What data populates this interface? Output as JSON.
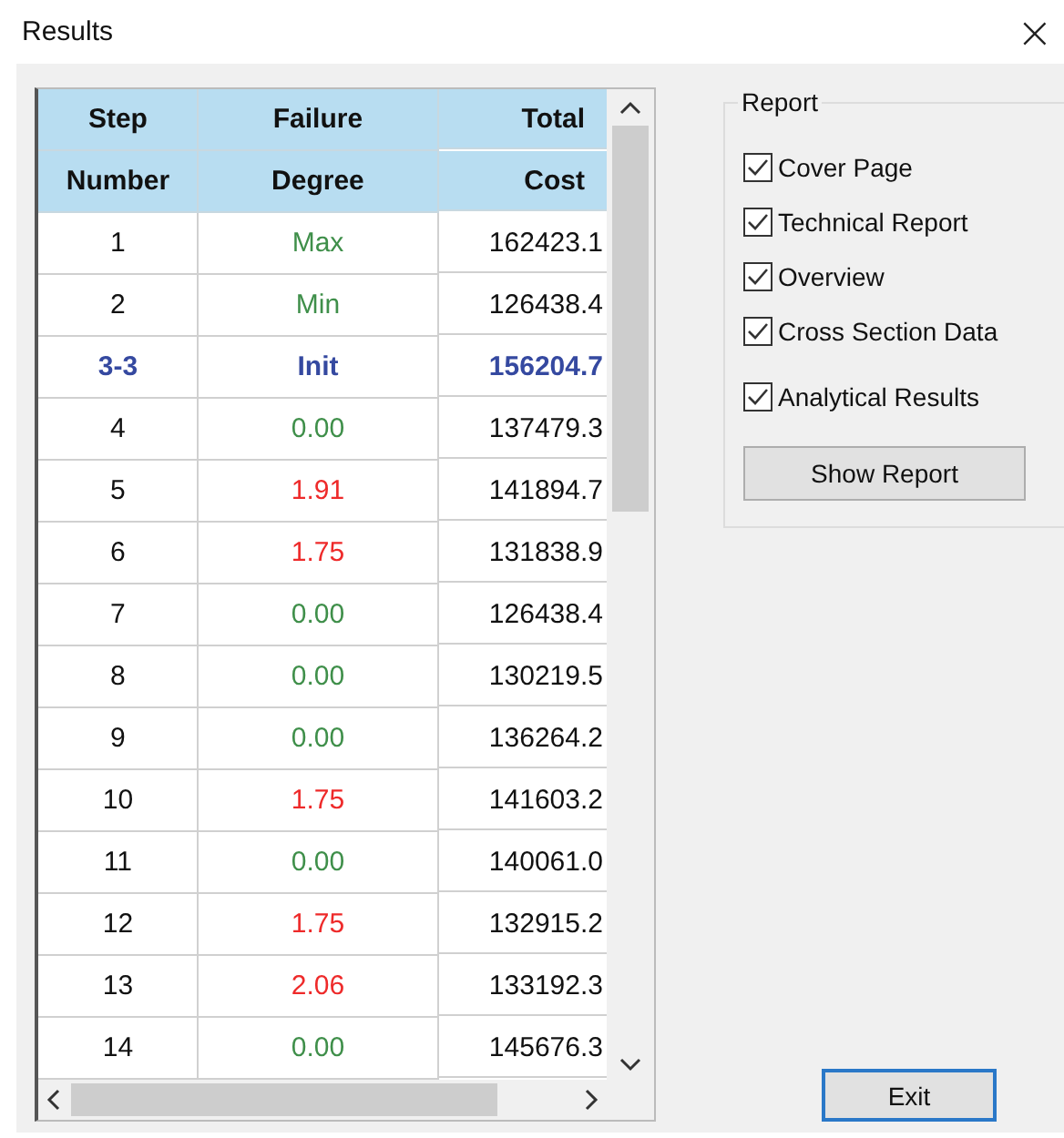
{
  "window": {
    "title": "Results",
    "close": "×"
  },
  "table": {
    "columns": [
      {
        "lines": [
          "Step",
          "Number"
        ]
      },
      {
        "lines": [
          "Failure",
          "Degree"
        ]
      },
      {
        "lines": [
          "Total",
          "Cost"
        ]
      }
    ],
    "rows": [
      {
        "step": "1",
        "degree": "Max",
        "cost": "162423.1",
        "kind": "ok"
      },
      {
        "step": "2",
        "degree": "Min",
        "cost": "126438.4",
        "kind": "ok"
      },
      {
        "step": "3-3",
        "degree": "Init",
        "cost": "156204.7",
        "kind": "current"
      },
      {
        "step": "4",
        "degree": "0.00",
        "cost": "137479.3",
        "kind": "ok"
      },
      {
        "step": "5",
        "degree": "1.91",
        "cost": "141894.7",
        "kind": "over"
      },
      {
        "step": "6",
        "degree": "1.75",
        "cost": "131838.9",
        "kind": "over"
      },
      {
        "step": "7",
        "degree": "0.00",
        "cost": "126438.4",
        "kind": "ok"
      },
      {
        "step": "8",
        "degree": "0.00",
        "cost": "130219.5",
        "kind": "ok"
      },
      {
        "step": "9",
        "degree": "0.00",
        "cost": "136264.2",
        "kind": "ok"
      },
      {
        "step": "10",
        "degree": "1.75",
        "cost": "141603.2",
        "kind": "over"
      },
      {
        "step": "11",
        "degree": "0.00",
        "cost": "140061.0",
        "kind": "ok"
      },
      {
        "step": "12",
        "degree": "1.75",
        "cost": "132915.2",
        "kind": "over"
      },
      {
        "step": "13",
        "degree": "2.06",
        "cost": "133192.3",
        "kind": "over"
      },
      {
        "step": "14",
        "degree": "0.00",
        "cost": "145676.3",
        "kind": "ok"
      }
    ]
  },
  "report": {
    "title": "Report",
    "options": [
      {
        "label": "Cover Page",
        "checked": true
      },
      {
        "label": "Technical Report",
        "checked": true
      },
      {
        "label": "Overview",
        "checked": true
      },
      {
        "label": "Cross Section Data",
        "checked": true
      },
      {
        "label": "Analytical Results",
        "checked": true
      }
    ],
    "button": "Show Report"
  },
  "exit_button": "Exit"
}
